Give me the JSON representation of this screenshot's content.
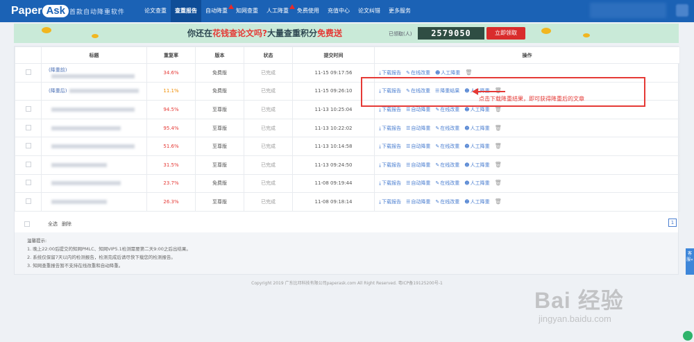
{
  "header": {
    "logo_text": "Paper",
    "logo_badge": "Ask",
    "slogan": "首款自动降重软件",
    "nav": [
      {
        "label": "论文查重",
        "active": false,
        "hot": false
      },
      {
        "label": "查重报告",
        "active": true,
        "hot": false
      },
      {
        "label": "自动降重",
        "active": false,
        "hot": true
      },
      {
        "label": "知网查重",
        "active": false,
        "hot": false
      },
      {
        "label": "人工降重",
        "active": false,
        "hot": true
      },
      {
        "label": "免费使用",
        "active": false,
        "hot": false
      },
      {
        "label": "充值中心",
        "active": false,
        "hot": false
      },
      {
        "label": "论文纠错",
        "active": false,
        "hot": false
      },
      {
        "label": "更多服务",
        "active": false,
        "hot": false
      }
    ]
  },
  "banner": {
    "text_prefix": "你还在",
    "text_red1": "花钱查论文吗?",
    "text_mid": "大量查重积分",
    "text_red2": "免费送",
    "count_label": "已领取(人)",
    "count": "2579050",
    "button": "立即领取"
  },
  "table": {
    "headers": [
      "",
      "标题",
      "重复率",
      "版本",
      "状态",
      "提交时间",
      "操作"
    ],
    "rows": [
      {
        "title": "(降重前)",
        "rate": "34.6%",
        "rate_color": "red",
        "version": "免费版",
        "status": "已完成",
        "time": "11-15 09:17:56",
        "ops": [
          "下载报告",
          "在线改重",
          "人工降重"
        ],
        "checkbox": true
      },
      {
        "title": "(降重后)",
        "rate": "11.1%",
        "rate_color": "orange",
        "version": "免费版",
        "status": "已完成",
        "time": "11-15 09:26:10",
        "ops": [
          "下载报告",
          "在线改重",
          "降重结果",
          "人工降重"
        ],
        "checkbox": false
      },
      {
        "title": "",
        "rate": "94.5%",
        "rate_color": "red",
        "version": "至尊版",
        "status": "已完成",
        "time": "11-13 10:25:04",
        "ops": [
          "下载报告",
          "自动降重",
          "在线改重",
          "人工降重"
        ],
        "checkbox": true
      },
      {
        "title": "",
        "rate": "95.4%",
        "rate_color": "red",
        "version": "至尊版",
        "status": "已完成",
        "time": "11-13 10:22:02",
        "ops": [
          "下载报告",
          "自动降重",
          "在线改重",
          "人工降重"
        ],
        "checkbox": true
      },
      {
        "title": "",
        "rate": "51.6%",
        "rate_color": "red",
        "version": "至尊版",
        "status": "已完成",
        "time": "11-13 10:14:58",
        "ops": [
          "下载报告",
          "自动降重",
          "在线改重",
          "人工降重"
        ],
        "checkbox": true
      },
      {
        "title": "",
        "rate": "31.5%",
        "rate_color": "red",
        "version": "至尊版",
        "status": "已完成",
        "time": "11-13 09:24:50",
        "ops": [
          "下载报告",
          "自动降重",
          "在线改重",
          "人工降重"
        ],
        "checkbox": true
      },
      {
        "title": "",
        "rate": "23.7%",
        "rate_color": "red",
        "version": "免费版",
        "status": "已完成",
        "time": "11-08 09:19:44",
        "ops": [
          "下载报告",
          "自动降重",
          "在线改重",
          "人工降重"
        ],
        "checkbox": true
      },
      {
        "title": "",
        "rate": "26.3%",
        "rate_color": "red",
        "version": "至尊版",
        "status": "已完成",
        "time": "11-08 09:18:14",
        "ops": [
          "下载报告",
          "自动降重",
          "在线改重",
          "人工降重"
        ],
        "checkbox": true
      }
    ]
  },
  "footer": {
    "select_all": "全选",
    "delete": "删除",
    "page": "1"
  },
  "tips": {
    "heading": "温馨提示:",
    "lines": [
      "1. 晚上22:00后提交的知网PMLC、知网VIP5.1检测需要第二天9:00之后出结果。",
      "2. 系统仅保留7天以内的检测报告，检测完成后请尽快下载您的检测报告。",
      "3. 知网查重报告暂不支持在线改重和自动降重。"
    ]
  },
  "copyright": "Copyright 2019 广东比邓科技有限公司paperask.com All Right Reserved. 粤ICP备19125200号-1",
  "annotation": "点击下载降重结果，即可获得降重后的文章",
  "side_tab": "客服«",
  "watermark": {
    "main": "Bai 经验",
    "sub": "jingyan.baidu.com"
  },
  "colors": {
    "nav_bg": "#1b62b5",
    "accent_red": "#e53935",
    "link": "#4a7ed0"
  }
}
